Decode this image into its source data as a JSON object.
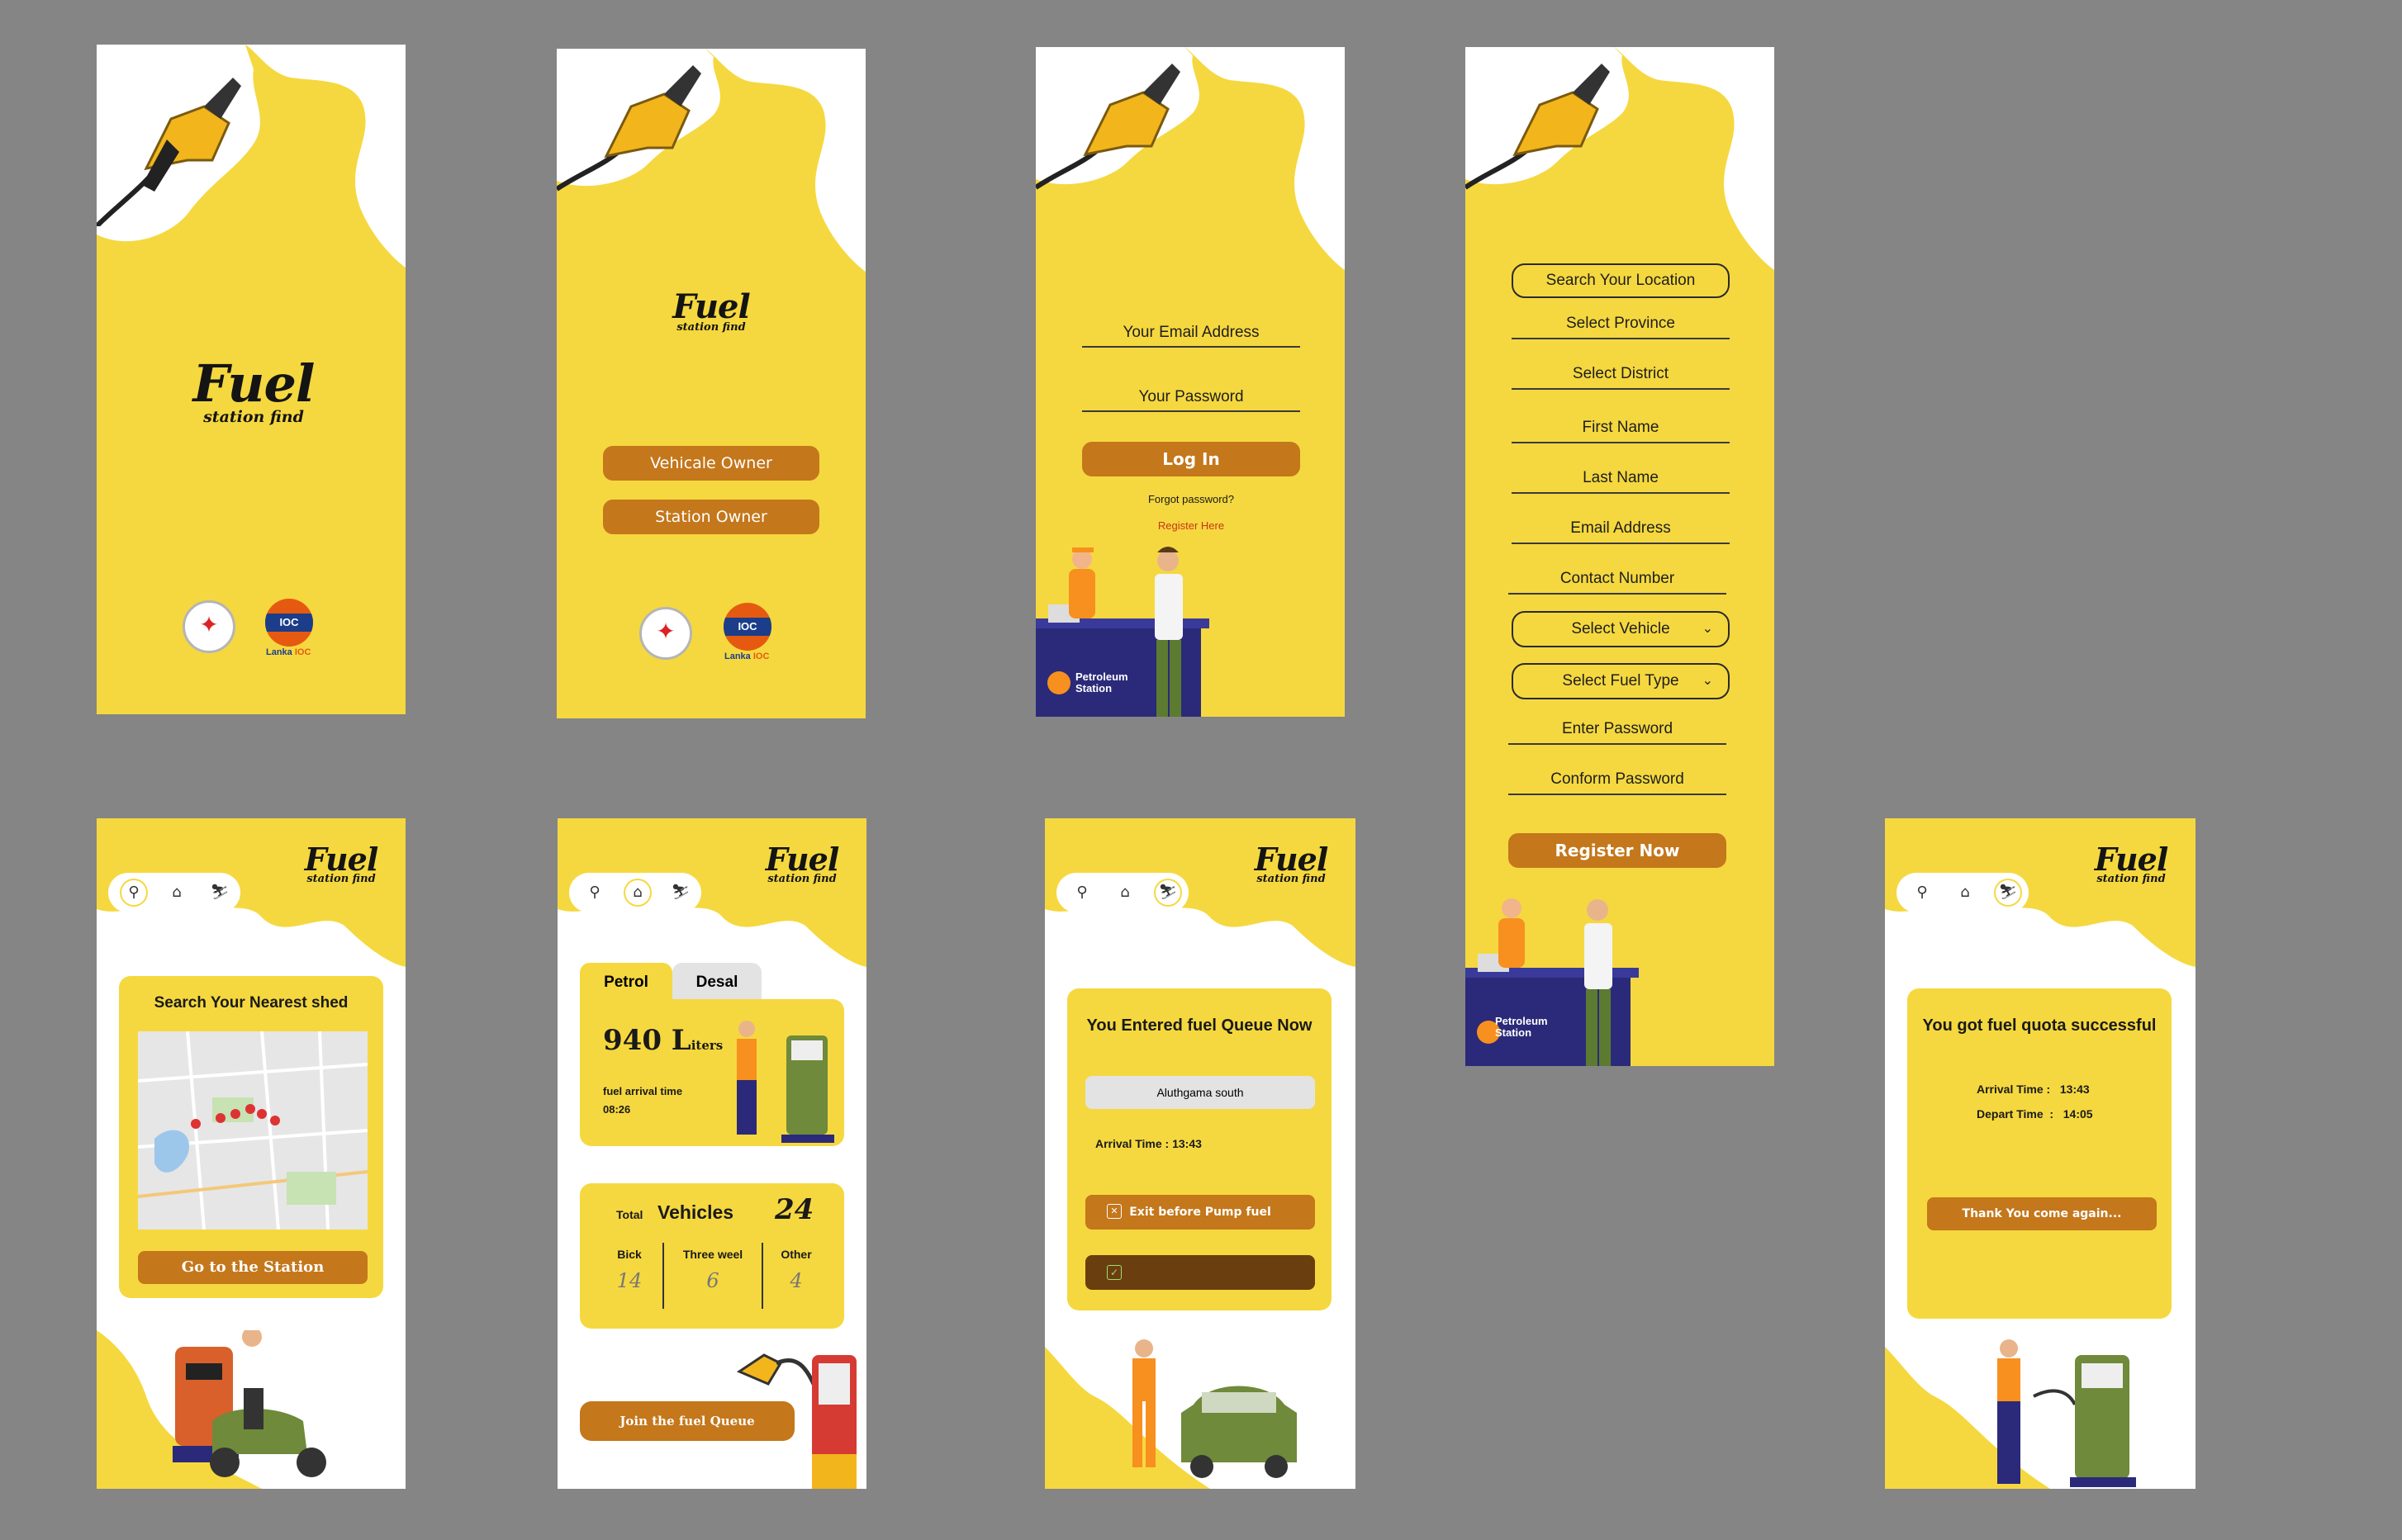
{
  "app": {
    "logo_title": "Fuel",
    "logo_subtitle": "station find"
  },
  "splash": {
    "ioc_badge": "IOC",
    "ioc_caption_a": "Lanka",
    "ioc_caption_b": "IOC"
  },
  "role_select": {
    "vehicle_owner": "Vehicale Owner",
    "station_owner": "Station Owner"
  },
  "login": {
    "email_placeholder": "Your Email  Address",
    "password_placeholder": "Your Password",
    "login_button": "Log In",
    "forgot": "Forgot password?",
    "register_link": "Register Here",
    "station_sign": "Petroleum Station"
  },
  "register": {
    "search_location": "Search Your Location",
    "province": "Select Province",
    "district": "Select District",
    "first_name": "First Name",
    "last_name": "Last Name",
    "email": "Email Address",
    "contact": "Contact Number",
    "vehicle": "Select Vehicle",
    "fuel_type": "Select Fuel Type",
    "password": "Enter Password",
    "confirm_password": "Conform Password",
    "register_button": "Register Now",
    "station_sign": "Petroleum Station"
  },
  "map_screen": {
    "card_title": "Search Your Nearest shed",
    "go_button": "Go to the Station"
  },
  "dashboard": {
    "tab_petrol": "Petrol",
    "tab_diesel": "Desal",
    "liters_value": "940 L",
    "liters_unit": "iters",
    "arrival_label": "fuel arrival time",
    "arrival_value": "08:26",
    "total_label": "Total",
    "vehicles_label": "Vehicles",
    "total_vehicles": "24",
    "stats": [
      {
        "label": "Bick",
        "value": "14"
      },
      {
        "label": "Three weel",
        "value": "6"
      },
      {
        "label": "Other",
        "value": "4"
      }
    ],
    "join_button": "Join the fuel Queue"
  },
  "queue": {
    "title": "You Entered fuel Queue Now",
    "station": "Aluthgama south",
    "arrival": "Arrival Time :  13:43",
    "exit_button": "Exit before Pump fuel"
  },
  "success": {
    "title": "You got fuel quota successful",
    "arrival": "Arrival Time :   13:43",
    "depart": "Depart Time  :   14:05",
    "thanks_button": "Thank You  come again..."
  },
  "colors": {
    "yellow": "#F5D83F",
    "brown": "#C4771B",
    "dark_brown": "#6B3E10",
    "navy": "#2B2A7A",
    "background": "#858585"
  }
}
